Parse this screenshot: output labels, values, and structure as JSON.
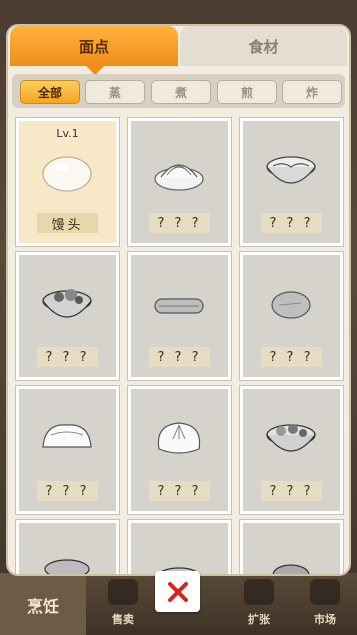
{
  "tabs": [
    {
      "label": "面点",
      "active": true
    },
    {
      "label": "食材",
      "active": false
    }
  ],
  "filters": [
    {
      "label": "全部",
      "active": true
    },
    {
      "label": "蒸",
      "active": false
    },
    {
      "label": "煮",
      "active": false
    },
    {
      "label": "煎",
      "active": false
    },
    {
      "label": "炸",
      "active": false
    }
  ],
  "cards": [
    {
      "level": "Lv.1",
      "name": "馒头",
      "known": true,
      "icon": "steamed-bun-icon"
    },
    {
      "level": "",
      "name": "? ? ?",
      "known": false,
      "icon": "swirl-roll-icon"
    },
    {
      "level": "",
      "name": "? ? ?",
      "known": false,
      "icon": "noodle-bowl-icon"
    },
    {
      "level": "",
      "name": "? ? ?",
      "known": false,
      "icon": "soup-bowl-icon"
    },
    {
      "level": "",
      "name": "? ? ?",
      "known": false,
      "icon": "fried-dough-stick-icon"
    },
    {
      "level": "",
      "name": "? ? ?",
      "known": false,
      "icon": "pancake-icon"
    },
    {
      "level": "",
      "name": "? ? ?",
      "known": false,
      "icon": "bread-loaf-icon"
    },
    {
      "level": "",
      "name": "? ? ?",
      "known": false,
      "icon": "baozi-icon"
    },
    {
      "level": "",
      "name": "? ? ?",
      "known": false,
      "icon": "wonton-bowl-icon"
    },
    {
      "level": "",
      "name": "",
      "known": false,
      "icon": "dish-icon"
    },
    {
      "level": "",
      "name": "",
      "known": false,
      "icon": "dish-icon"
    },
    {
      "level": "",
      "name": "",
      "known": false,
      "icon": "dish-icon"
    }
  ],
  "bottom_nav": {
    "cook": "烹饪",
    "sell": "售卖",
    "expand": "扩张",
    "market": "市场"
  },
  "colors": {
    "accent": "#f08d17",
    "close_x": "#e02020"
  }
}
